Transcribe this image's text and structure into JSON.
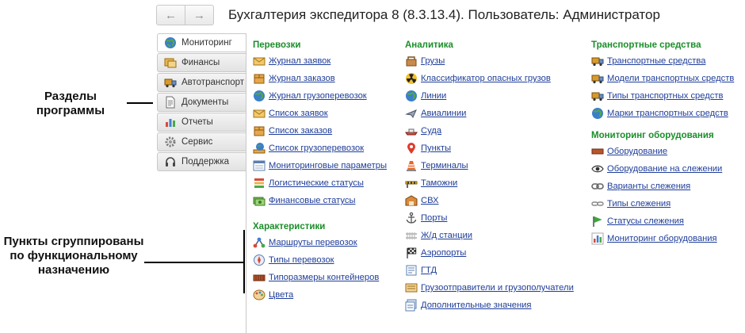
{
  "nav": {
    "back": "←",
    "forward": "→"
  },
  "title": "Бухгалтерия экспедитора 8 (8.3.13.4). Пользователь: Администратор",
  "sections": [
    {
      "label": "Мониторинг",
      "icon": "globe-icon",
      "active": true
    },
    {
      "label": "Финансы",
      "icon": "finance-icon"
    },
    {
      "label": "Автотранспорт",
      "icon": "truck-icon"
    },
    {
      "label": "Документы",
      "icon": "document-icon"
    },
    {
      "label": "Отчеты",
      "icon": "chart-icon"
    },
    {
      "label": "Сервис",
      "icon": "gear-icon"
    },
    {
      "label": "Поддержка",
      "icon": "headset-icon"
    }
  ],
  "callouts": {
    "sections_label": "Разделы программы",
    "grouping_label": "Пункты сгруппированы по функциональному назначению"
  },
  "groups": {
    "perevozki": {
      "title": "Перевозки",
      "items": [
        {
          "label": "Журнал заявок",
          "icon": "envelope-icon"
        },
        {
          "label": "Журнал заказов",
          "icon": "box-icon"
        },
        {
          "label": "Журнал грузоперевозок",
          "icon": "globe-icon"
        },
        {
          "label": "Список заявок",
          "icon": "envelope-icon"
        },
        {
          "label": "Список заказов",
          "icon": "box-icon"
        },
        {
          "label": "Список грузоперевозок",
          "icon": "globe-stack-icon"
        },
        {
          "label": "Мониторинговые параметры",
          "icon": "list-icon"
        },
        {
          "label": "Логистические статусы",
          "icon": "stack-icon"
        },
        {
          "label": "Финансовые статусы",
          "icon": "money-icon"
        }
      ]
    },
    "harakteristiki": {
      "title": "Характеристики",
      "items": [
        {
          "label": "Маршруты перевозок",
          "icon": "route-icon"
        },
        {
          "label": "Типы перевозок",
          "icon": "compass-icon"
        },
        {
          "label": "Типоразмеры контейнеров",
          "icon": "container-icon"
        },
        {
          "label": "Цвета",
          "icon": "palette-icon"
        }
      ]
    },
    "analitika": {
      "title": "Аналитика",
      "items": [
        {
          "label": "Грузы",
          "icon": "cargo-icon"
        },
        {
          "label": "Классификатор опасных грузов",
          "icon": "hazard-icon"
        },
        {
          "label": "Линии",
          "icon": "globe-icon"
        },
        {
          "label": "Авиалинии",
          "icon": "airplane-icon"
        },
        {
          "label": "Суда",
          "icon": "ship-icon"
        },
        {
          "label": "Пункты",
          "icon": "pin-icon"
        },
        {
          "label": "Терминалы",
          "icon": "cone-icon"
        },
        {
          "label": "Таможни",
          "icon": "customs-icon"
        },
        {
          "label": "СВХ",
          "icon": "warehouse-icon"
        },
        {
          "label": " Порты",
          "icon": "anchor-icon"
        },
        {
          "label": "Ж/д станции",
          "icon": "rail-icon"
        },
        {
          "label": "Аэропорты",
          "icon": "flag-icon"
        },
        {
          "label": "ГТД",
          "icon": "declaration-icon"
        },
        {
          "label": "Грузоотправители и грузополучатели",
          "icon": "people-icon"
        },
        {
          "label": "Дополнительные значения",
          "icon": "values-icon"
        }
      ]
    },
    "transport": {
      "title": "Транспортные средства",
      "items": [
        {
          "label": "Транспортные средства",
          "icon": "truck-icon"
        },
        {
          "label": "Модели транспортных средств",
          "icon": "truck-icon"
        },
        {
          "label": "Типы транспортных средств",
          "icon": "truck-icon"
        },
        {
          "label": "Марки транспортных средств",
          "icon": "globe-icon"
        }
      ]
    },
    "monitoring": {
      "title": "Мониторинг оборудования",
      "items": [
        {
          "label": "Оборудование",
          "icon": "equipment-icon"
        },
        {
          "label": "Оборудование на слежении",
          "icon": "eye-icon"
        },
        {
          "label": "Варианты слежения",
          "icon": "chain-icon"
        },
        {
          "label": "Типы слежения",
          "icon": "link-icon"
        },
        {
          "label": "Статусы слежения",
          "icon": "green-flag-icon"
        },
        {
          "label": "Мониторинг оборудования",
          "icon": "chart-icon"
        }
      ]
    }
  }
}
